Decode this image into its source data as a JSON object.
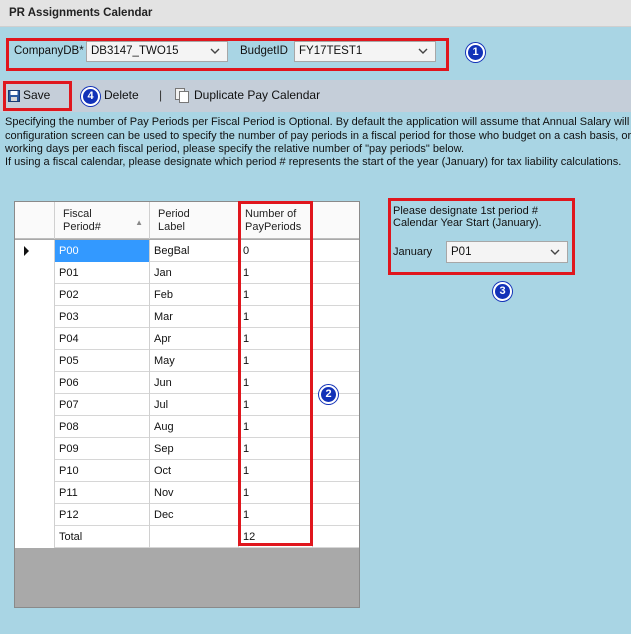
{
  "window": {
    "title": "PR Assignments Calendar"
  },
  "filters": {
    "company_label": "CompanyDB*",
    "company_value": "DB3147_TWO15",
    "budget_label": "BudgetID",
    "budget_value": "FY17TEST1"
  },
  "toolbar": {
    "save_label": "Save",
    "delete_label": "Delete",
    "separator": "|",
    "duplicate_label": "Duplicate Pay Calendar"
  },
  "info": {
    "line1": "Specifying the number of Pay Periods per Fiscal Period is Optional. By default the application will assume that Annual Salary will be s",
    "line2": "configuration screen can be used to specify the number of pay periods in a fiscal period for those who budget on a cash basis, or d",
    "line3": "working days per each fiscal period, please specify the relative number of \"pay periods\" below.",
    "line4": "If using a fiscal calendar, please designate which period # represents the start of the year (January) for tax liability calculations."
  },
  "grid": {
    "columns": [
      "Fiscal\nPeriod#",
      "Period\nLabel",
      "Number of\nPayPeriods"
    ],
    "rows": [
      [
        "P00",
        "BegBal",
        "0"
      ],
      [
        "P01",
        "Jan",
        "1"
      ],
      [
        "P02",
        "Feb",
        "1"
      ],
      [
        "P03",
        "Mar",
        "1"
      ],
      [
        "P04",
        "Apr",
        "1"
      ],
      [
        "P05",
        "May",
        "1"
      ],
      [
        "P06",
        "Jun",
        "1"
      ],
      [
        "P07",
        "Jul",
        "1"
      ],
      [
        "P08",
        "Aug",
        "1"
      ],
      [
        "P09",
        "Sep",
        "1"
      ],
      [
        "P10",
        "Oct",
        "1"
      ],
      [
        "P11",
        "Nov",
        "1"
      ],
      [
        "P12",
        "Dec",
        "1"
      ],
      [
        "Total",
        "",
        "12"
      ]
    ],
    "selected_row": 0
  },
  "year_start": {
    "line1": "Please designate 1st period #",
    "line2": "Calendar Year Start (January).",
    "month_label": "January",
    "period_value": "P01"
  },
  "callouts": {
    "c1": "1",
    "c2": "2",
    "c3": "3",
    "c4": "4"
  },
  "colors": {
    "panel_bg": "#a9d5e4",
    "toolbar_bg": "#c5ced9",
    "highlight": "#e0161d",
    "callout": "#1232b8",
    "selection": "#3399ff"
  }
}
